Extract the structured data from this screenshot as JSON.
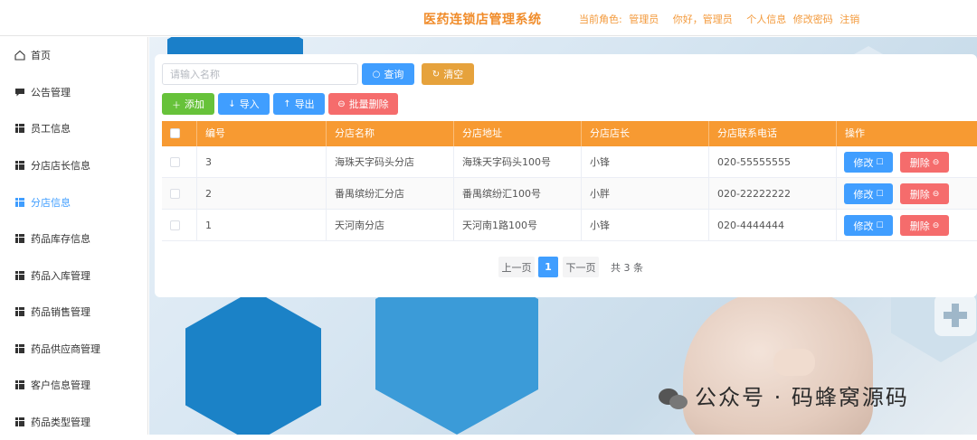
{
  "header": {
    "title": "医药连锁店管理系统",
    "role_label": "当前角色:",
    "role_value": "管理员",
    "greeting": "你好，管理员",
    "profile_link": "个人信息",
    "password_link": "修改密码",
    "logout_link": "注销"
  },
  "sidebar": {
    "items": [
      {
        "label": "首页",
        "icon": "home-icon"
      },
      {
        "label": "公告管理",
        "icon": "chat-icon"
      },
      {
        "label": "员工信息",
        "icon": "grid-icon"
      },
      {
        "label": "分店店长信息",
        "icon": "grid-icon"
      },
      {
        "label": "分店信息",
        "icon": "grid-icon",
        "active": true
      },
      {
        "label": "药品库存信息",
        "icon": "grid-icon"
      },
      {
        "label": "药品入库管理",
        "icon": "grid-icon"
      },
      {
        "label": "药品销售管理",
        "icon": "grid-icon"
      },
      {
        "label": "药品供应商管理",
        "icon": "grid-icon"
      },
      {
        "label": "客户信息管理",
        "icon": "grid-icon"
      },
      {
        "label": "药品类型管理",
        "icon": "grid-icon"
      }
    ]
  },
  "search": {
    "placeholder": "请输入名称",
    "value": "",
    "query_label": "查询",
    "clear_label": "清空"
  },
  "toolbar": {
    "add_label": "添加",
    "import_label": "导入",
    "export_label": "导出",
    "bulk_delete_label": "批量删除"
  },
  "table": {
    "columns": [
      "编号",
      "分店名称",
      "分店地址",
      "分店店长",
      "分店联系电话",
      "操作"
    ],
    "rows": [
      {
        "id": "3",
        "name": "海珠天字码头分店",
        "address": "海珠天字码头100号",
        "manager": "小锋",
        "phone": "020-55555555"
      },
      {
        "id": "2",
        "name": "番禺缤纷汇分店",
        "address": "番禺缤纷汇100号",
        "manager": "小胖",
        "phone": "020-22222222"
      },
      {
        "id": "1",
        "name": "天河南分店",
        "address": "天河南1路100号",
        "manager": "小锋",
        "phone": "020-4444444"
      }
    ],
    "edit_label": "修改",
    "delete_label": "删除"
  },
  "pagination": {
    "prev_label": "上一页",
    "current_page": "1",
    "next_label": "下一页",
    "total_text": "共 3 条"
  },
  "watermark": {
    "text": "公众号 · 码蜂窝源码"
  },
  "colors": {
    "accent": "#409eff",
    "header_orange": "#f79a32",
    "title_orange": "#f08c2a",
    "success": "#67c23a",
    "warning": "#e6a23c",
    "danger": "#f56c6c"
  }
}
